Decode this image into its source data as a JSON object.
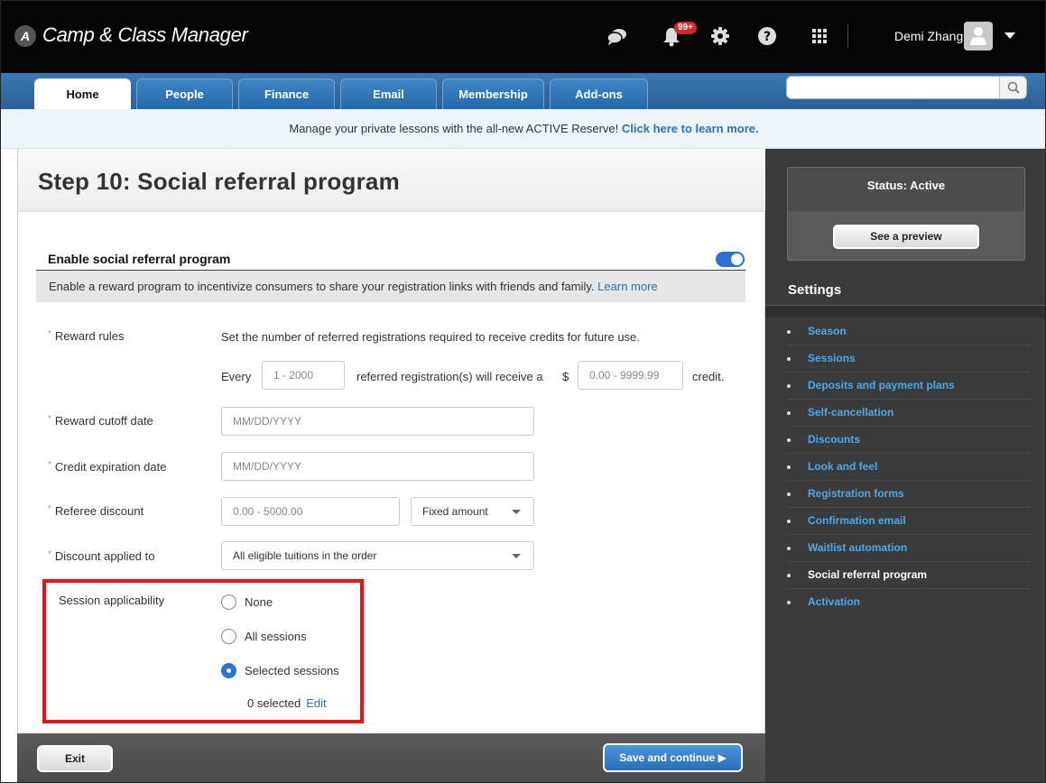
{
  "app": {
    "logo_glyph": "A",
    "title": "Camp & Class Manager"
  },
  "topbar": {
    "notification_count": "99+",
    "user_name": "Demi Zhang"
  },
  "nav": {
    "tabs": [
      {
        "label": "Home",
        "active": true
      },
      {
        "label": "People"
      },
      {
        "label": "Finance"
      },
      {
        "label": "Email"
      },
      {
        "label": "Membership"
      },
      {
        "label": "Add-ons"
      }
    ],
    "search_placeholder": ""
  },
  "announcement": {
    "text": "Manage your private lessons with the all-new ACTIVE Reserve!",
    "link": "Click here to learn more."
  },
  "page": {
    "title": "Step 10: Social referral program"
  },
  "section": {
    "title": "Enable social referral program",
    "enabled": true,
    "description": "Enable a reward program to incentivize consumers to share your registration links with friends and family.",
    "learn_more": "Learn more"
  },
  "form": {
    "required_mark": "*",
    "reward_rules": {
      "label": "Reward rules",
      "instruction": "Set the number of referred registrations required to receive credits for future use.",
      "every": "Every",
      "count_placeholder": "1 - 2000",
      "middle_text": "referred registration(s) will receive a",
      "currency": "$",
      "credit_placeholder": "0.00 - 9999.99",
      "suffix": "credit."
    },
    "reward_cutoff": {
      "label": "Reward cutoff date",
      "placeholder": "MM/DD/YYYY"
    },
    "credit_expiration": {
      "label": "Credit expiration date",
      "placeholder": "MM/DD/YYYY"
    },
    "referee_discount": {
      "label": "Referee discount",
      "placeholder": "0.00 - 5000.00",
      "type_value": "Fixed amount"
    },
    "discount_applied": {
      "label": "Discount applied to",
      "value": "All eligible tuitions in the order"
    },
    "session_applicability": {
      "label": "Session applicability",
      "options": [
        "None",
        "All sessions",
        "Selected sessions"
      ],
      "selected_index": 2,
      "selected_count": "0 selected",
      "edit": "Edit"
    }
  },
  "sidebar": {
    "status": "Status: Active",
    "preview_button": "See a preview",
    "settings_heading": "Settings",
    "items": [
      "Season",
      "Sessions",
      "Deposits and payment plans",
      "Self-cancellation",
      "Discounts",
      "Look and feel",
      "Registration forms",
      "Confirmation email",
      "Waitlist automation",
      "Social referral program",
      "Activation"
    ],
    "current_index": 9
  },
  "footer": {
    "exit": "Exit",
    "save": "Save and continue ▶"
  },
  "colors": {
    "accent": "#2a73d3",
    "link": "#2a73b8",
    "highlight": "#e4141b",
    "sidebar_link": "#4aa9ea"
  }
}
